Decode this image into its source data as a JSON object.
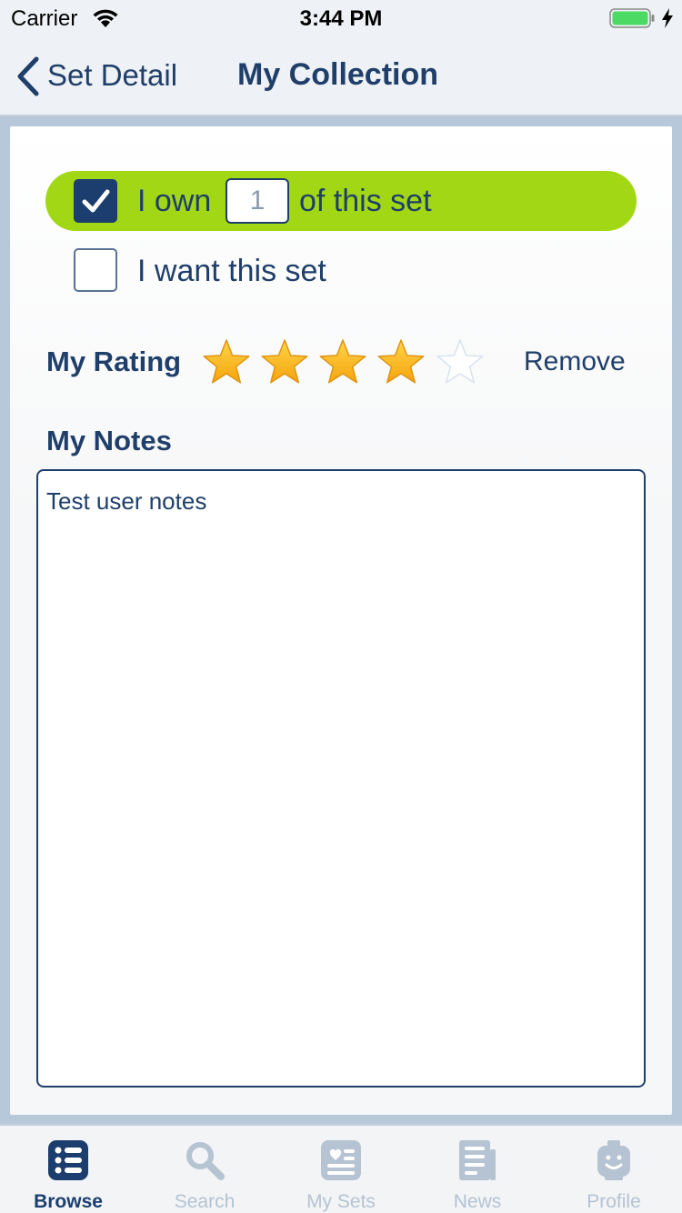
{
  "status_bar": {
    "carrier": "Carrier",
    "time": "3:44 PM"
  },
  "nav": {
    "back_label": "Set Detail",
    "title": "My Collection"
  },
  "collection": {
    "own_checked": true,
    "own_prefix": "I own",
    "own_quantity": "1",
    "own_suffix": "of this set",
    "want_checked": false,
    "want_label": "I want this set"
  },
  "rating": {
    "label": "My Rating",
    "value": 4,
    "max": 5,
    "remove_label": "Remove"
  },
  "notes": {
    "label": "My Notes",
    "value": "Test user notes"
  },
  "tabs": [
    {
      "label": "Browse",
      "icon": "list-icon",
      "active": true
    },
    {
      "label": "Search",
      "icon": "search-icon",
      "active": false
    },
    {
      "label": "My Sets",
      "icon": "my-sets-icon",
      "active": false
    },
    {
      "label": "News",
      "icon": "news-icon",
      "active": false
    },
    {
      "label": "Profile",
      "icon": "profile-icon",
      "active": false
    }
  ],
  "colors": {
    "accent": "#1c3e6e",
    "own_highlight": "#a2d715",
    "star": "#f8b81c",
    "inactive_tab": "#b5c3d2"
  }
}
